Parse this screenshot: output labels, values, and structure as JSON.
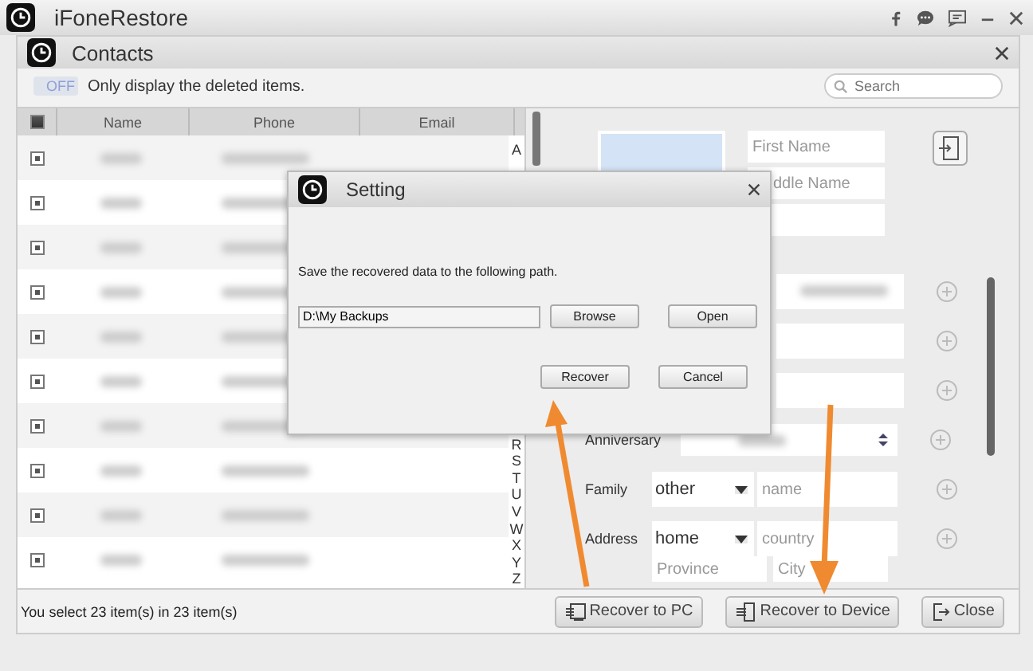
{
  "app": {
    "title": "iFoneRestore"
  },
  "panel": {
    "title": "Contacts"
  },
  "filter": {
    "on": false,
    "toggle_label": "OFF",
    "label": "Only display the deleted items."
  },
  "search": {
    "placeholder": "Search"
  },
  "table": {
    "all_checked": true,
    "columns": [
      "Name",
      "Phone",
      "Email"
    ],
    "rows": [
      {
        "checked": true
      },
      {
        "checked": true
      },
      {
        "checked": true
      },
      {
        "checked": true
      },
      {
        "checked": true
      },
      {
        "checked": true
      },
      {
        "checked": true
      },
      {
        "checked": true
      },
      {
        "checked": true
      },
      {
        "checked": true
      }
    ],
    "index_letters": [
      "A",
      "R",
      "S",
      "T",
      "U",
      "V",
      "W",
      "X",
      "Y",
      "Z"
    ]
  },
  "detail": {
    "name_fields": [
      {
        "placeholder": "First Name"
      },
      {
        "placeholder": "ddle Name"
      }
    ],
    "labels": [
      "Anniversary",
      "Family",
      "Address"
    ],
    "family": {
      "type": "other",
      "placeholder": "name"
    },
    "address": {
      "type": "home",
      "placeholder": "country",
      "province_placeholder": "Province",
      "city_placeholder": "City"
    }
  },
  "status": "You select 23 item(s) in 23 item(s)",
  "buttons": [
    {
      "kind": "pc",
      "label": "Recover to PC"
    },
    {
      "kind": "device",
      "label": "Recover to Device"
    },
    {
      "kind": "close",
      "label": "Close"
    }
  ],
  "dialog": {
    "title": "Setting",
    "message": "Save the recovered data to the following path.",
    "path": "D:\\My Backups",
    "buttons": [
      "Browse",
      "Open",
      "Recover",
      "Cancel"
    ]
  }
}
